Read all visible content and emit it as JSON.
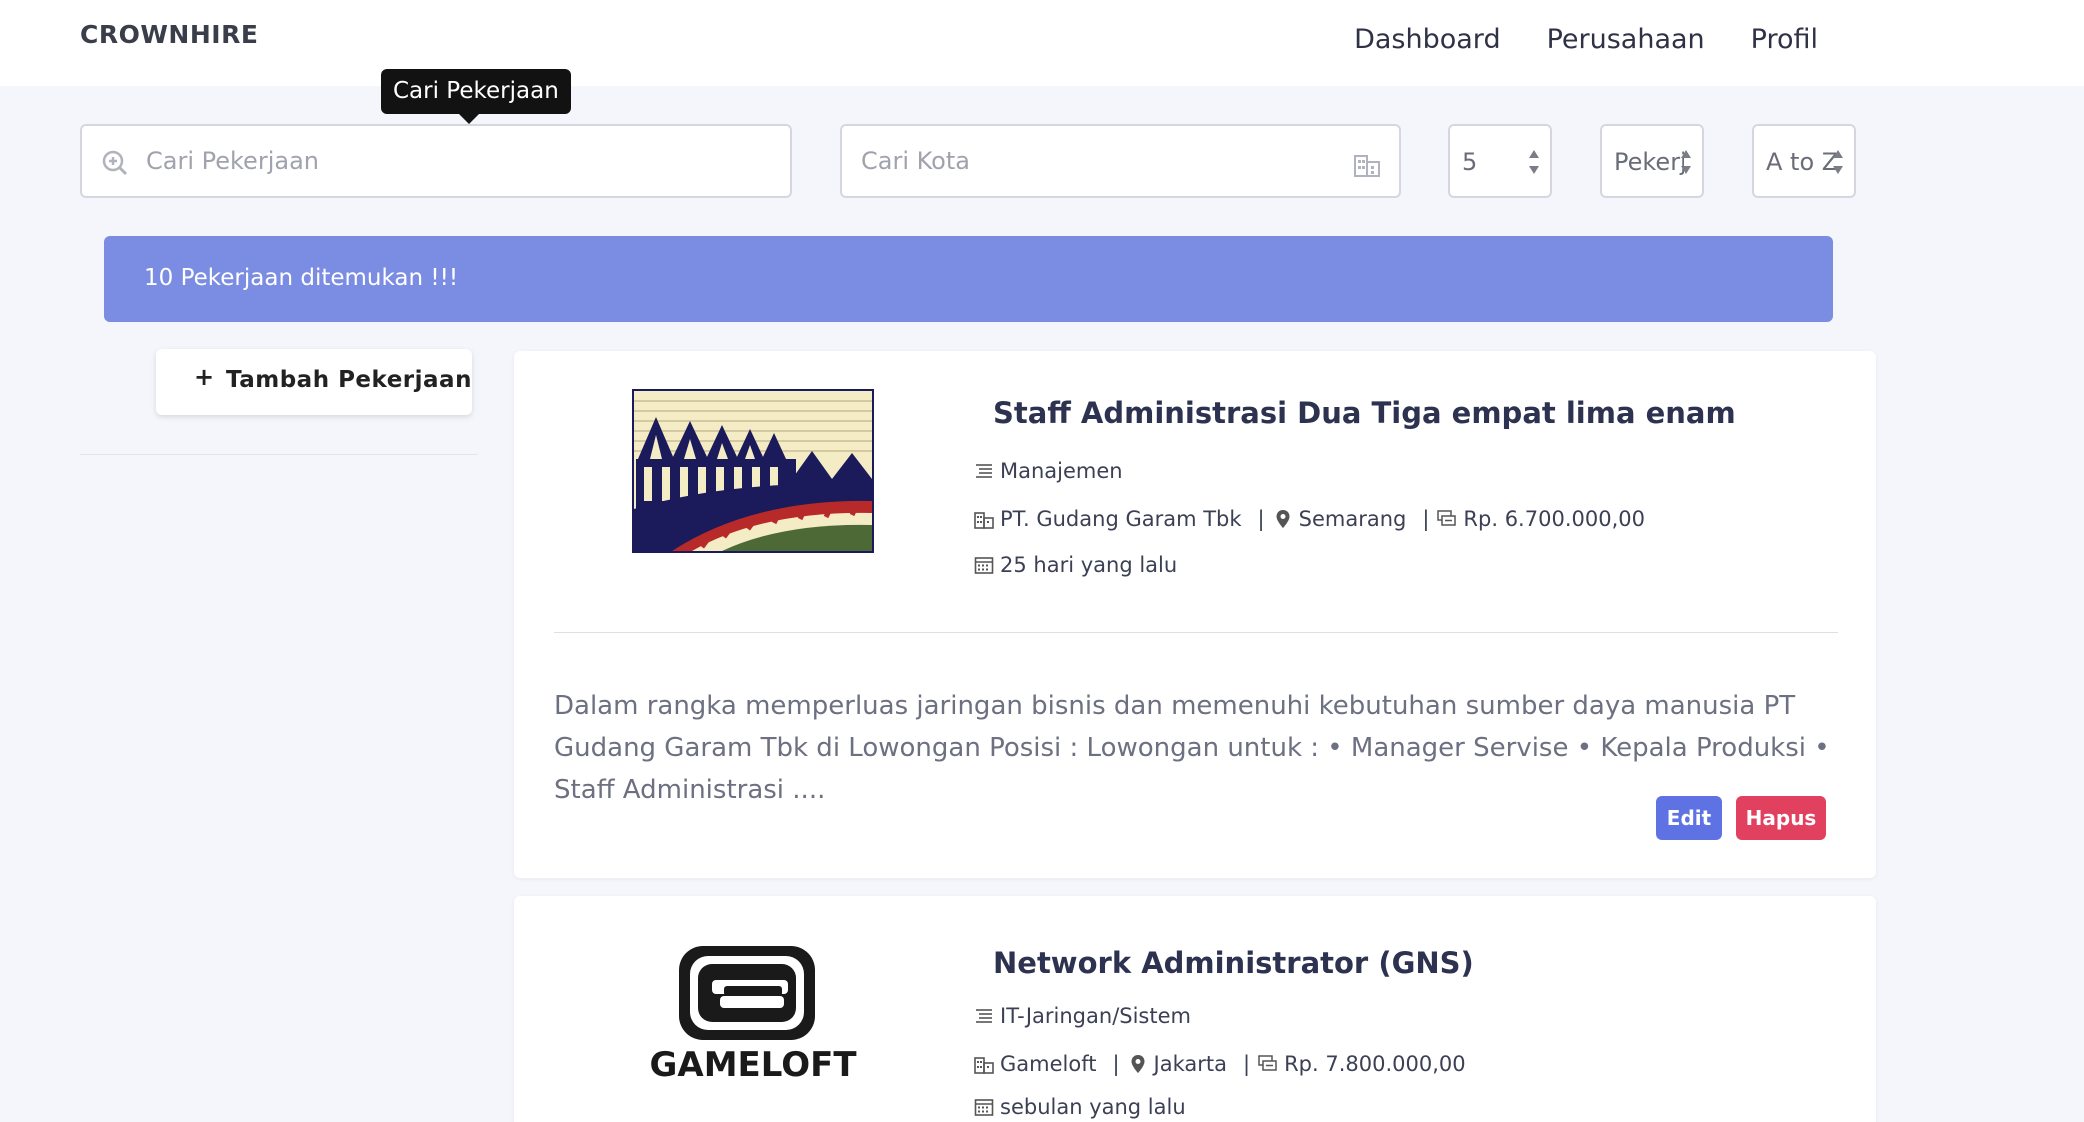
{
  "brand": "CROWNHIRE",
  "nav": [
    "Dashboard",
    "Perusahaan",
    "Profil"
  ],
  "tooltip": "Cari Pekerjaan",
  "filters": {
    "search_placeholder": "Cari Pekerjaan",
    "city_placeholder": "Cari Kota",
    "count_value": "5",
    "type_value": "Pekerj",
    "sort_value": "A to Z"
  },
  "result_banner": "10 Pekerjaan ditemukan !!!",
  "add_button": {
    "icon": "+",
    "label": "Tambah Pekerjaan"
  },
  "jobs": [
    {
      "title": "Staff Administrasi Dua Tiga empat lima enam",
      "category": "Manajemen",
      "company": "PT. Gudang Garam Tbk",
      "city": "Semarang",
      "salary": "Rp. 6.700.000,00",
      "posted": "25 hari yang lalu",
      "description": "Dalam rangka memperluas jaringan bisnis dan memenuhi kebutuhan sumber daya manusia PT Gudang Garam Tbk di Lowongan Posisi : Lowongan untuk : • Manager Servise • Kepala Produksi • Staff Administrasi ....",
      "edit_label": "Edit",
      "delete_label": "Hapus"
    },
    {
      "title": "Network Administrator (GNS)",
      "category": "IT-Jaringan/Sistem",
      "company": "Gameloft",
      "city": "Jakarta",
      "salary": "Rp. 7.800.000,00",
      "posted": "sebulan yang lalu",
      "logo_text": "GAMELOFT"
    }
  ],
  "separator": "|",
  "colors": {
    "banner": "#7b8ce3",
    "edit": "#5e72e4",
    "delete": "#e2405f",
    "background": "#f4f6fb"
  },
  "icons": [
    "search-icon",
    "building-icon",
    "list-icon",
    "building-small-icon",
    "map-pin-icon",
    "money-icon",
    "calendar-icon"
  ]
}
